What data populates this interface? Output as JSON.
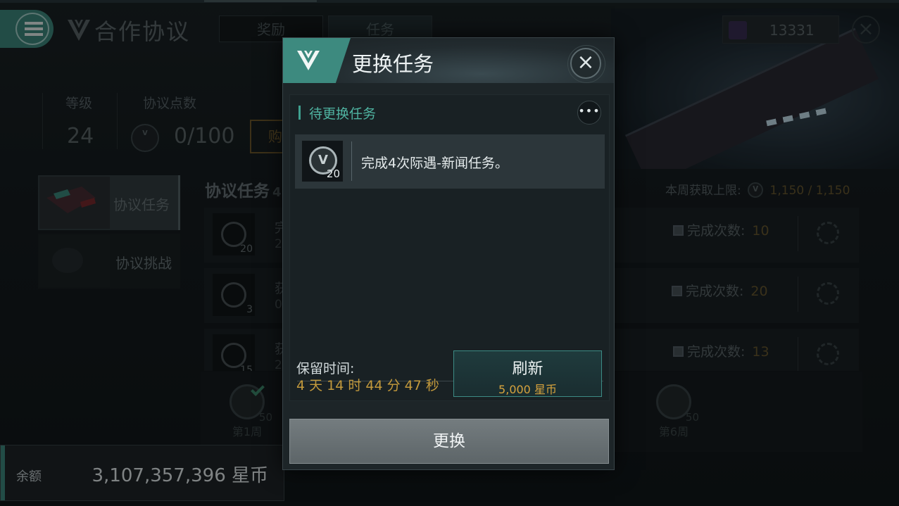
{
  "header": {
    "title": "合作协议",
    "tabs": [
      {
        "label": "奖励",
        "active": false
      },
      {
        "label": "任务",
        "active": true
      }
    ],
    "currency_value": "13331",
    "close_icon": "×"
  },
  "stats": {
    "level_label": "等级",
    "level_value": "24",
    "points_label": "协议点数",
    "points_value": "0/100",
    "buy_label": "购"
  },
  "sidebar": {
    "items": [
      {
        "label": "协议任务",
        "active": true
      },
      {
        "label": "协议挑战",
        "active": false
      }
    ]
  },
  "tasks_section": {
    "title": "协议任务",
    "title_suffix": "4",
    "weekly_limit_label": "本周获取上限:",
    "weekly_limit_value": "1,150 / 1,150",
    "rows": [
      {
        "icon_num": "20",
        "title_fragment": "完",
        "sub_fragment": "2",
        "count_label": "完成次数:",
        "count_value": "10"
      },
      {
        "icon_num": "3",
        "title_fragment": "获",
        "sub_fragment": "0",
        "count_label": "完成次数:",
        "count_value": "20"
      },
      {
        "icon_num": "15",
        "title_fragment": "获",
        "sub_fragment": "2",
        "count_label": "完成次数:",
        "count_value": "13"
      }
    ]
  },
  "weeks": [
    {
      "label": "第1周",
      "num": "50",
      "done": true
    },
    {
      "label": "第6周",
      "num": "50",
      "done": false
    }
  ],
  "balance": {
    "label": "余额",
    "value": "3,107,357,396 星币"
  },
  "modal": {
    "title": "更换任务",
    "close_icon": "×",
    "pending_label": "待更换任务",
    "more_icon": "•••",
    "pending_task": {
      "icon_num": "20",
      "description": "完成4次际遇-新闻任务。"
    },
    "keep_time_label": "保留时间:",
    "keep_time_value": "4 天 14 时 44 分 47 秒",
    "refresh_label": "刷新",
    "refresh_cost": "5,000 星币",
    "swap_label": "更换"
  },
  "colors": {
    "accent_teal": "#3f8b80",
    "gold": "#c49a3c"
  },
  "icons": [
    "menu-icon",
    "alliance-logo-icon",
    "currency-icon",
    "close-icon",
    "more-icon",
    "agreement-coin-icon",
    "refresh-icon",
    "check-icon"
  ]
}
